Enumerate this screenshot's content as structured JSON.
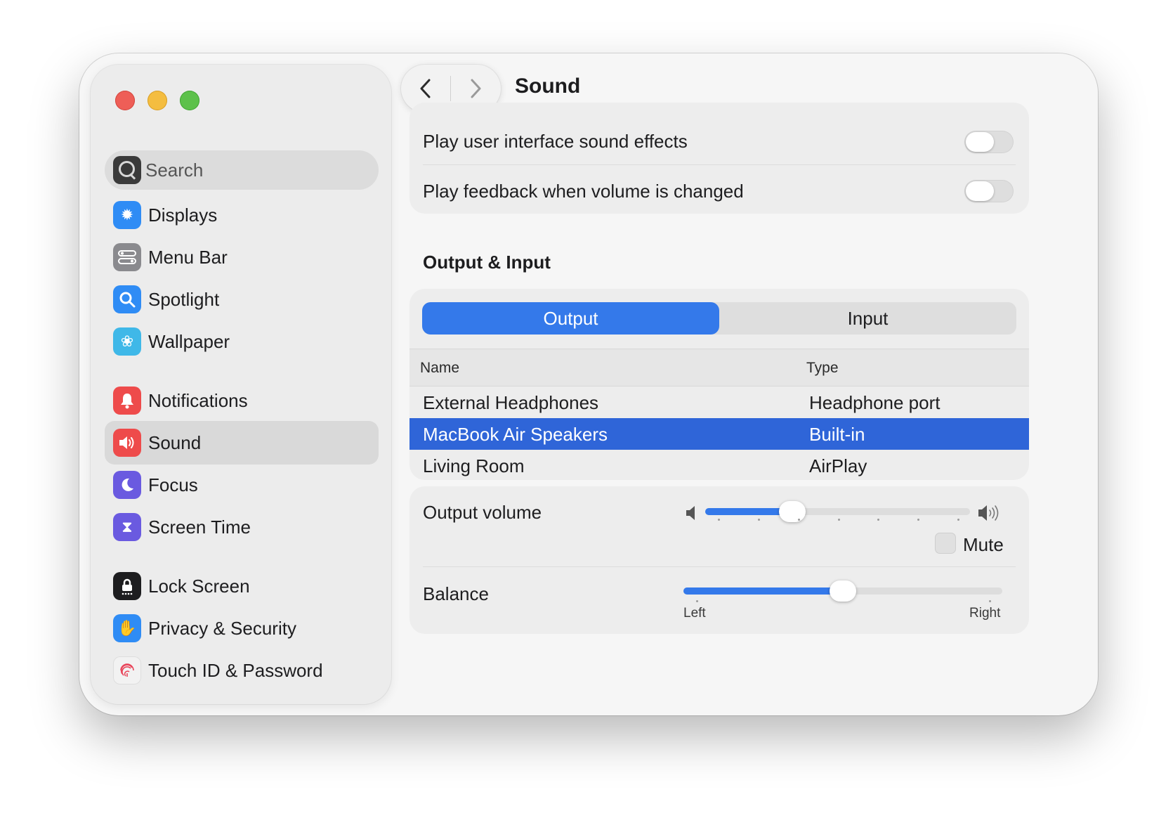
{
  "window": {
    "title": "Sound",
    "colors": {
      "accent": "#3479ea",
      "selection": "#2f65d8",
      "close": "#ee5e57",
      "minimize": "#f4bd40",
      "zoom": "#5dc14b"
    }
  },
  "search": {
    "placeholder": "Search"
  },
  "sidebar": {
    "items": [
      {
        "label": "Displays",
        "icon": "sun-icon",
        "color": "#2f8cf5"
      },
      {
        "label": "Menu Bar",
        "icon": "menu-bar-icon",
        "color": "#8a8a8e"
      },
      {
        "label": "Spotlight",
        "icon": "magnifier-icon",
        "color": "#2f8cf5"
      },
      {
        "label": "Wallpaper",
        "icon": "flower-icon",
        "color": "#3fb8e8"
      },
      {
        "label": "Notifications",
        "icon": "bell-icon",
        "color": "#ee4b4b"
      },
      {
        "label": "Sound",
        "icon": "speaker-icon",
        "color": "#ee4b4b",
        "selected": true
      },
      {
        "label": "Focus",
        "icon": "moon-icon",
        "color": "#6a5ae0"
      },
      {
        "label": "Screen Time",
        "icon": "hourglass-icon",
        "color": "#6a5ae0"
      },
      {
        "label": "Lock Screen",
        "icon": "lock-icon",
        "color": "#1d1d1f"
      },
      {
        "label": "Privacy & Security",
        "icon": "hand-icon",
        "color": "#2f8cf5"
      },
      {
        "label": "Touch ID & Password",
        "icon": "fingerprint-icon",
        "color": "#f2f2f2"
      }
    ]
  },
  "effects": {
    "ui_sounds_label": "Play user interface sound effects",
    "ui_sounds_on": false,
    "volume_feedback_label": "Play feedback when volume is changed",
    "volume_feedback_on": false
  },
  "output_input": {
    "section_title": "Output & Input",
    "tabs": [
      "Output",
      "Input"
    ],
    "active_tab": "Output",
    "columns": {
      "name": "Name",
      "type": "Type"
    },
    "devices": [
      {
        "name": "External Headphones",
        "type": "Headphone port"
      },
      {
        "name": "MacBook Air Speakers",
        "type": "Built-in",
        "selected": true
      },
      {
        "name": "Living Room",
        "type": "AirPlay"
      }
    ]
  },
  "volume": {
    "label": "Output volume",
    "level": 0.33,
    "mute_label": "Mute",
    "muted": false
  },
  "balance": {
    "label": "Balance",
    "level": 0.5,
    "left_label": "Left",
    "right_label": "Right"
  }
}
